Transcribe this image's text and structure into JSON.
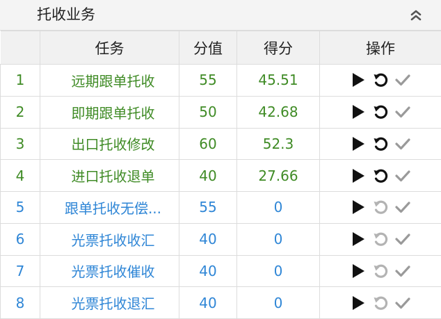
{
  "panel": {
    "title": "托收业务",
    "collapse_icon": "double-chevron-up-icon"
  },
  "table": {
    "headers": {
      "index": "",
      "task": "任务",
      "value": "分值",
      "score": "得分",
      "actions": "操作"
    },
    "rows": [
      {
        "index": "1",
        "task": "远期跟单托收",
        "value": "55",
        "score": "45.51",
        "status": "done"
      },
      {
        "index": "2",
        "task": "即期跟单托收",
        "value": "50",
        "score": "42.68",
        "status": "done"
      },
      {
        "index": "3",
        "task": "出口托收修改",
        "value": "60",
        "score": "52.3",
        "status": "done"
      },
      {
        "index": "4",
        "task": "进口托收退单",
        "value": "40",
        "score": "27.66",
        "status": "done"
      },
      {
        "index": "5",
        "task": "跟单托收无偿...",
        "value": "55",
        "score": "0",
        "status": "todo"
      },
      {
        "index": "6",
        "task": "光票托收收汇",
        "value": "40",
        "score": "0",
        "status": "todo"
      },
      {
        "index": "7",
        "task": "光票托收催收",
        "value": "40",
        "score": "0",
        "status": "todo"
      },
      {
        "index": "8",
        "task": "光票托收退汇",
        "value": "40",
        "score": "0",
        "status": "todo"
      }
    ]
  },
  "icons": {
    "start": "play-icon",
    "reset": "redo-icon",
    "submit": "check-icon"
  },
  "colors": {
    "done_text": "#3f8b25",
    "todo_text": "#2f86d6",
    "icon_active": "#111111",
    "icon_disabled": "#b3b3b3",
    "check": "#9a9a9a"
  }
}
